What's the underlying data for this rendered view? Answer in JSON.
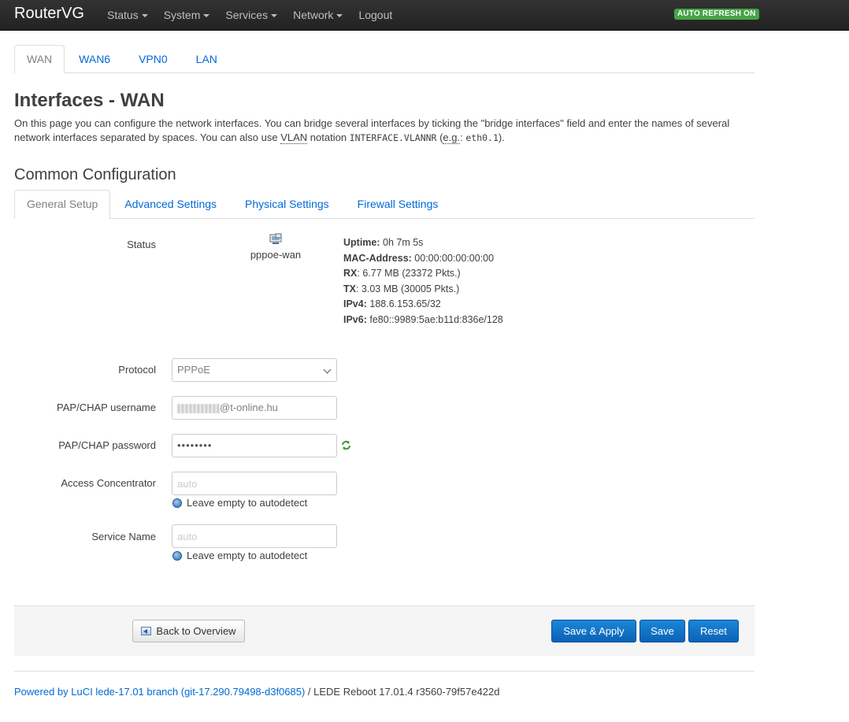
{
  "navbar": {
    "brand": "RouterVG",
    "menu": [
      {
        "label": "Status",
        "dropdown": true
      },
      {
        "label": "System",
        "dropdown": true
      },
      {
        "label": "Services",
        "dropdown": true
      },
      {
        "label": "Network",
        "dropdown": true
      },
      {
        "label": "Logout",
        "dropdown": false
      }
    ],
    "auto_refresh": "AUTO REFRESH ON",
    "auto_refresh_color": "#46a546"
  },
  "interface_tabs": [
    "WAN",
    "WAN6",
    "VPN0",
    "LAN"
  ],
  "page": {
    "title": "Interfaces - WAN",
    "intro_1": "On this page you can configure the network interfaces. You can bridge several interfaces by ticking the \"bridge interfaces\" field and enter the names of several network interfaces separated by spaces. You can also use ",
    "intro_vlan": "VLAN",
    "intro_2": " notation ",
    "intro_code1": "INTERFACE.VLANNR",
    "intro_3": " (",
    "intro_eg": "e.g.",
    "intro_4": ": ",
    "intro_code2": "eth0.1",
    "intro_5": ")."
  },
  "section": {
    "title": "Common Configuration",
    "tabs": [
      "General Setup",
      "Advanced Settings",
      "Physical Settings",
      "Firewall Settings"
    ]
  },
  "status": {
    "label": "Status",
    "device": "pppoe-wan",
    "device_icon": "network-device-icon",
    "uptime_label": "Uptime:",
    "uptime": "0h 7m 5s",
    "mac_label": "MAC-Address:",
    "mac": "00:00:00:00:00:00",
    "rx_label": "RX",
    "rx": ": 6.77 MB (23372 Pkts.)",
    "tx_label": "TX",
    "tx": ": 3.03 MB (30005 Pkts.)",
    "ipv4_label": "IPv4:",
    "ipv4": "188.6.153.65/32",
    "ipv6_label": "IPv6:",
    "ipv6": "fe80::9989:5ae:b11d:836e/128"
  },
  "form": {
    "protocol_label": "Protocol",
    "protocol_value": "PPPoE",
    "username_label": "PAP/CHAP username",
    "username_suffix": "@t-online.hu",
    "password_label": "PAP/CHAP password",
    "password_value": "••••••••",
    "ac_label": "Access Concentrator",
    "ac_placeholder": "auto",
    "ac_hint": "Leave empty to autodetect",
    "service_label": "Service Name",
    "service_placeholder": "auto",
    "service_hint": "Leave empty to autodetect"
  },
  "actions": {
    "back": "Back to Overview",
    "save_apply": "Save & Apply",
    "save": "Save",
    "reset": "Reset",
    "primary_color": "#0b62b5"
  },
  "footer": {
    "link": "Powered by LuCI lede-17.01 branch (git-17.290.79498-d3f0685)",
    "text": " / LEDE Reboot 17.01.4 r3560-79f57e422d"
  }
}
